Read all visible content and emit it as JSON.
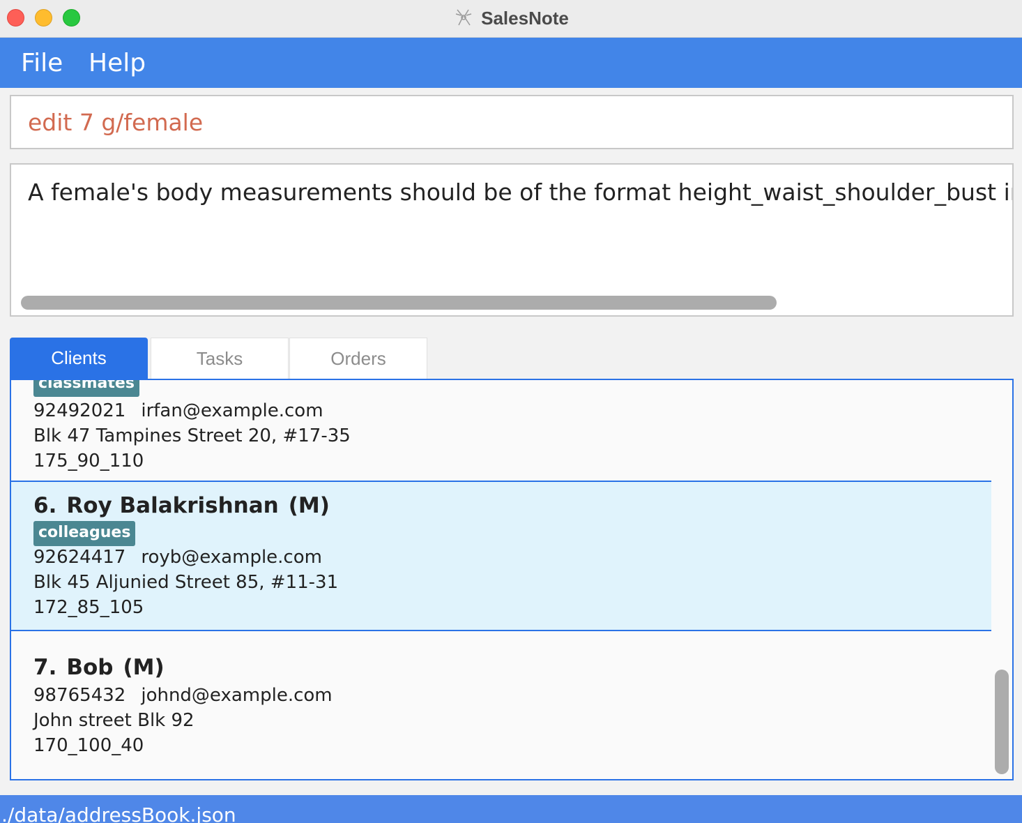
{
  "window": {
    "title": "SalesNote",
    "icon": "app-logo-icon"
  },
  "menu": {
    "file": "File",
    "help": "Help"
  },
  "command": {
    "value": "edit 7 g/female"
  },
  "result": {
    "message": "A female's body measurements should be of the format height_waist_shoulder_bust in cm,"
  },
  "tabs": [
    {
      "label": "Clients",
      "active": true
    },
    {
      "label": "Tasks",
      "active": false
    },
    {
      "label": "Orders",
      "active": false
    }
  ],
  "clients": {
    "partial": {
      "tag": "classmates",
      "phone": "92492021",
      "email": "irfan@example.com",
      "address": "Blk 47 Tampines Street 20, #17-35",
      "measurements": "175_90_110"
    },
    "selected": {
      "index": "6.",
      "name": "Roy Balakrishnan",
      "gender": "(M)",
      "tag": "colleagues",
      "phone": "92624417",
      "email": "royb@example.com",
      "address": "Blk 45 Aljunied Street 85, #11-31",
      "measurements": "172_85_105"
    },
    "last": {
      "index": "7.",
      "name": "Bob",
      "gender": "(M)",
      "phone": "98765432",
      "email": "johnd@example.com",
      "address": "John street Blk 92",
      "measurements": "170_100_40"
    }
  },
  "status": {
    "path": "./data/addressBook.json"
  },
  "colors": {
    "accent": "#4285e8",
    "tab_active": "#2a72e6",
    "selected_row": "#e0f3fc",
    "tag": "#4b8792",
    "command_text": "#d26a50"
  }
}
